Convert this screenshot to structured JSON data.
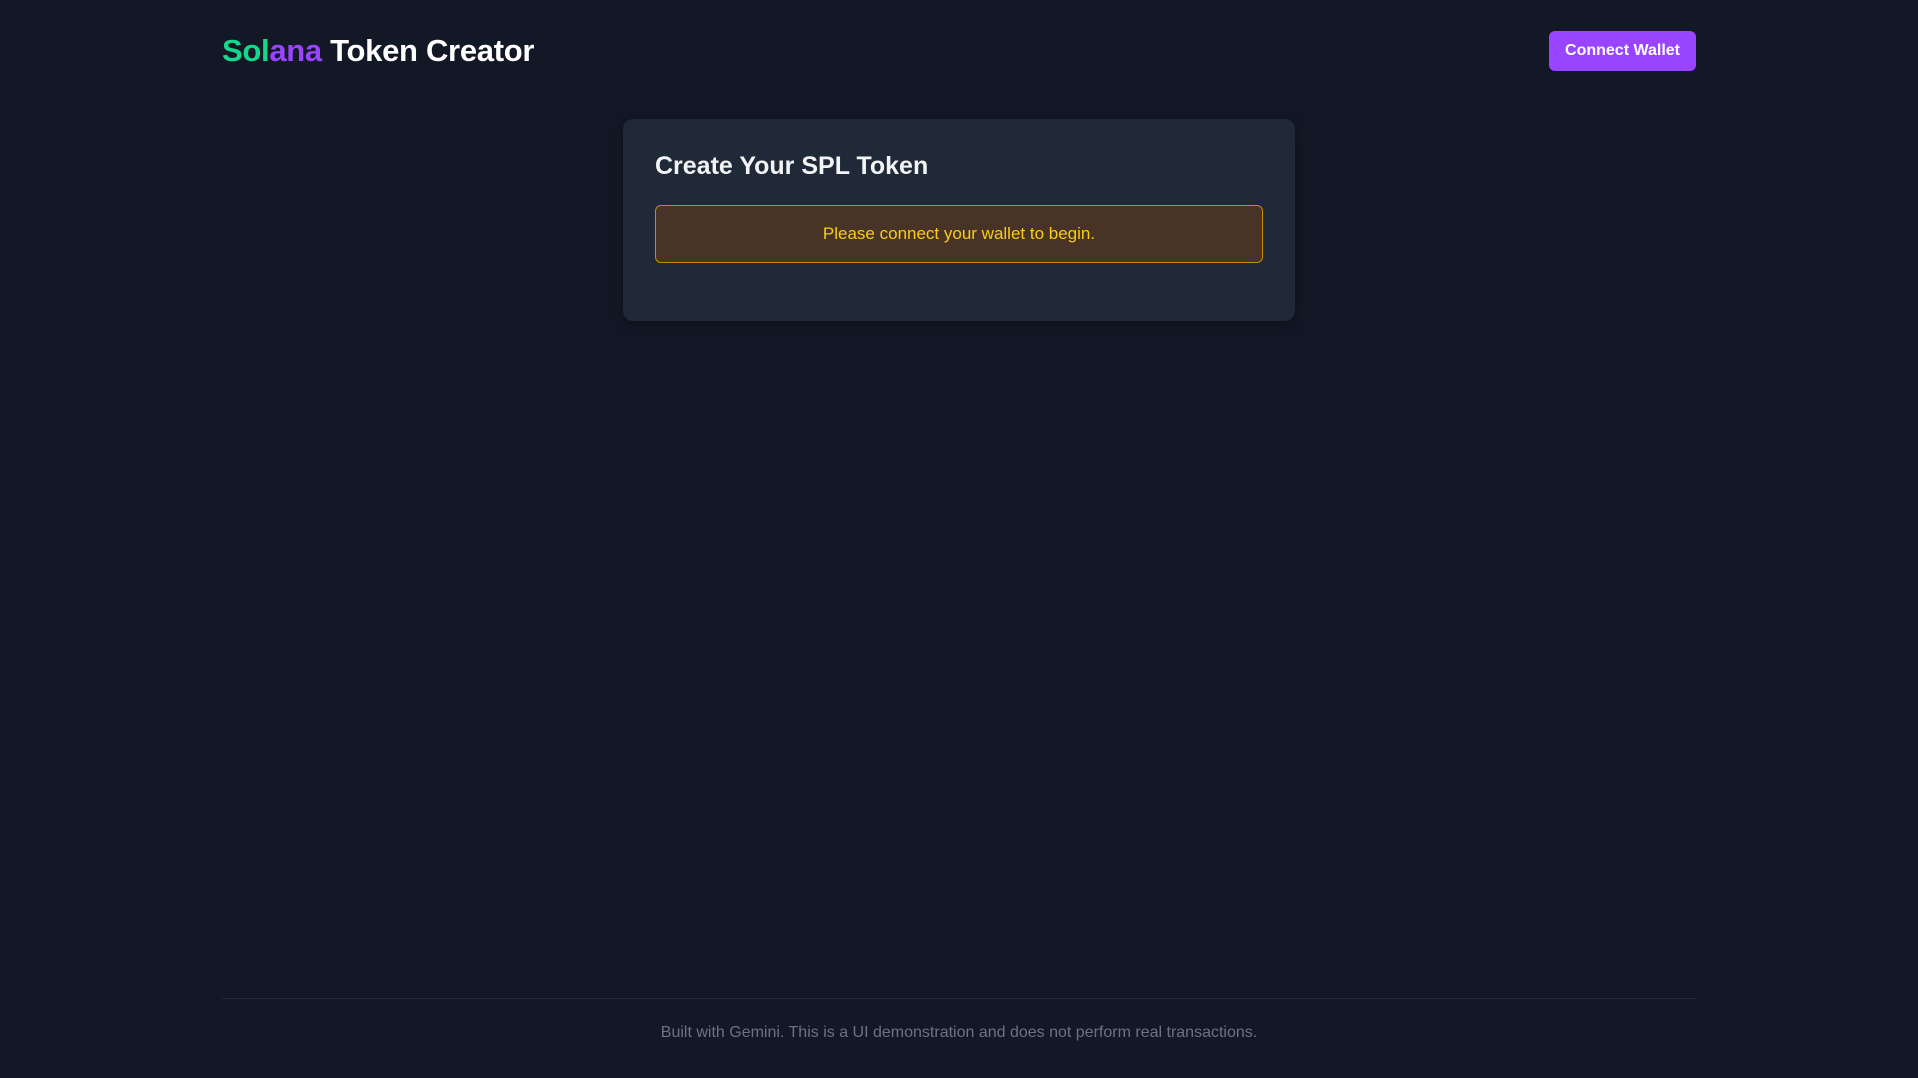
{
  "header": {
    "brand_part1": "Sol",
    "brand_part2": "ana",
    "brand_part3": " Token Creator",
    "connect_label": "Connect Wallet"
  },
  "card": {
    "title": "Create Your SPL Token",
    "notice": "Please connect your wallet to begin."
  },
  "footer": {
    "text": "Built with Gemini. This is a UI demonstration and does not perform real transactions."
  },
  "colors": {
    "background": "#121826",
    "card": "#1f2937",
    "accent_purple": "#9945ff",
    "accent_green": "#14d98a",
    "notice_text": "#facc15",
    "notice_border": "#ca8a04"
  }
}
